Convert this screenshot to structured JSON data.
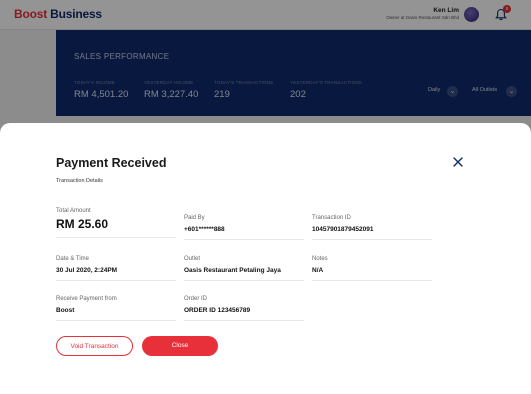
{
  "app": {
    "brand_prefix": "Boost",
    "brand_suffix": " Business",
    "user_name": "Ken Lim",
    "user_role": "Owner at Oasis Restaurant Sdn Bhd",
    "notification_count": "8"
  },
  "sales": {
    "title": "SALES PERFORMANCE",
    "stats": [
      {
        "label": "TODAY'S INCOME",
        "value": "RM 4,501.20"
      },
      {
        "label": "YESTERDAY INCOME",
        "value": "RM 3,227.40"
      },
      {
        "label": "TODAY'S TRANSACTIONS",
        "value": "219"
      },
      {
        "label": "YESTERDAY'S TRANSACTIONS",
        "value": "202"
      }
    ],
    "period_filter": "Daily",
    "outlet_filter": "All Outlets"
  },
  "modal": {
    "title": "Payment Received",
    "subtitle": "Transaction Details",
    "fields": {
      "total_amount": {
        "label": "Total Amount",
        "value": "RM 25.60"
      },
      "paid_by": {
        "label": "Paid By",
        "value": "+601******888"
      },
      "transaction_id": {
        "label": "Transaction ID",
        "value": "10457901879452091"
      },
      "date_time": {
        "label": "Date & Time",
        "value": "30 Jul 2020, 2:24PM"
      },
      "outlet": {
        "label": "Outlet",
        "value": "Oasis Restaurant Petaling Jaya"
      },
      "notes": {
        "label": "Notes",
        "value": "N/A"
      },
      "receive_from": {
        "label": "Receive Payment from",
        "value": "Boost"
      },
      "order_id": {
        "label": "Order ID",
        "value": "ORDER ID 123456789"
      }
    },
    "void_label": "Void Transaction",
    "close_label": "Close"
  },
  "colors": {
    "accent": "#e8303a",
    "navy": "#0e2a6b"
  },
  "icons": [
    "boost-logo",
    "avatar",
    "bell-icon",
    "chevron-down-icon",
    "close-icon"
  ]
}
